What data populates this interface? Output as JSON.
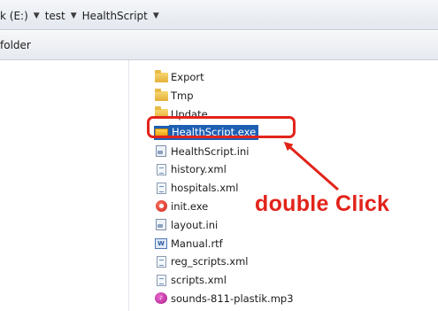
{
  "address_bar": {
    "crumbs": [
      "k (E:)",
      "test",
      "HealthScript"
    ],
    "separator": "▼"
  },
  "toolbar": {
    "folder_label": "folder"
  },
  "files": [
    {
      "name": "Export",
      "icon": "folder-icon"
    },
    {
      "name": "Tmp",
      "icon": "folder-icon"
    },
    {
      "name": "Update",
      "icon": "folder-icon"
    },
    {
      "name": "HealthScript.exe",
      "icon": "exe-icon",
      "selected": true
    },
    {
      "name": "HealthScript.ini",
      "icon": "ini-file-icon"
    },
    {
      "name": "history.xml",
      "icon": "xml-file-icon"
    },
    {
      "name": "hospitals.xml",
      "icon": "xml-file-icon"
    },
    {
      "name": "init.exe",
      "icon": "app-exe-icon"
    },
    {
      "name": "layout.ini",
      "icon": "ini-file-icon"
    },
    {
      "name": "Manual.rtf",
      "icon": "rtf-file-icon"
    },
    {
      "name": "reg_scripts.xml",
      "icon": "xml-file-icon"
    },
    {
      "name": "scripts.xml",
      "icon": "xml-file-icon"
    },
    {
      "name": "sounds-811-plastik.mp3",
      "icon": "mp3-file-icon"
    }
  ],
  "annotation": {
    "text": "double Click",
    "color": "#e2231a"
  },
  "colors": {
    "selection": "#1d5fb3",
    "highlight": "#e2241b"
  }
}
